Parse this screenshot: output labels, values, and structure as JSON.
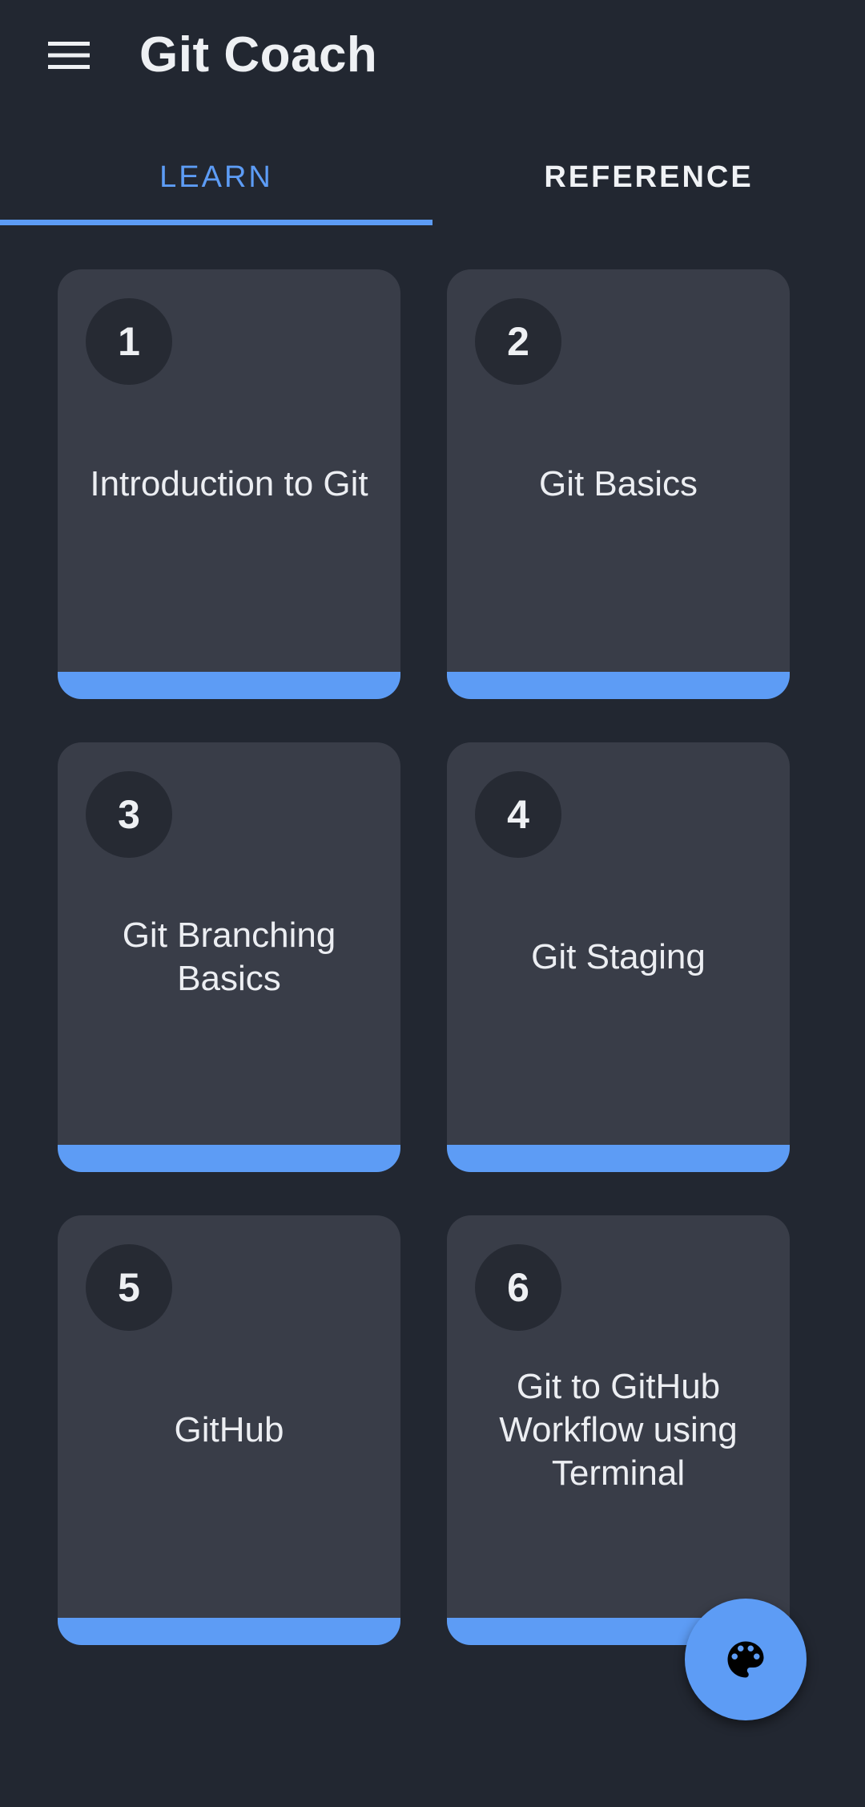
{
  "app": {
    "title": "Git Coach"
  },
  "tabs": [
    {
      "label": "LEARN",
      "selected": true
    },
    {
      "label": "REFERENCE",
      "selected": false
    }
  ],
  "colors": {
    "background": "#222731",
    "card": "#393d48",
    "accent": "#5d9cf5",
    "badge": "#262a33"
  },
  "lessons": [
    {
      "number": "1",
      "title": "Introduction to Git"
    },
    {
      "number": "2",
      "title": "Git Basics"
    },
    {
      "number": "3",
      "title": "Git Branching Basics"
    },
    {
      "number": "4",
      "title": "Git Staging"
    },
    {
      "number": "5",
      "title": "GitHub"
    },
    {
      "number": "6",
      "title": "Git to GitHub Workflow using Terminal"
    }
  ],
  "icons": {
    "menu": "hamburger-menu-icon",
    "fab": "palette-icon"
  }
}
